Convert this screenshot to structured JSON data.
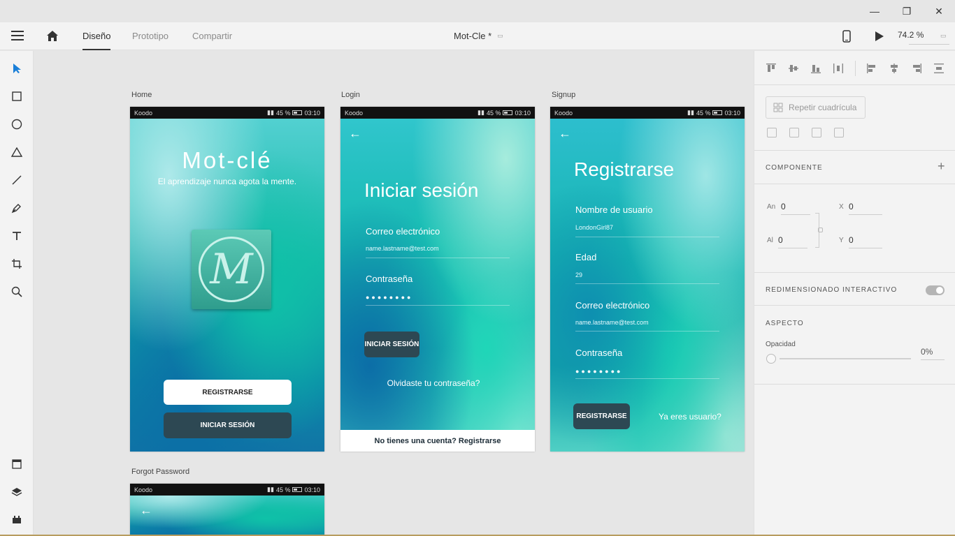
{
  "window": {
    "minimize": "—",
    "restore": "❐",
    "close": "✕"
  },
  "toolbar": {
    "tabs": [
      "Diseño",
      "Prototipo",
      "Compartir"
    ],
    "doc_title": "Mot-Cle *",
    "zoom": "74.2 %"
  },
  "canvas": {
    "artboards": {
      "home": {
        "label": "Home",
        "carrier": "Koodo",
        "battery": "45 %",
        "time": "03:10",
        "title": "Mot-clé",
        "subtitle": "El aprendizaje nunca agota la mente.",
        "logo_letter": "M",
        "register_btn": "REGISTRARSE",
        "login_btn": "INICIAR SESIÓN"
      },
      "login": {
        "label": "Login",
        "carrier": "Koodo",
        "battery": "45 %",
        "time": "03:10",
        "title": "Iniciar sesión",
        "email_label": "Correo electrónico",
        "email_value": "name.lastname@test.com",
        "password_label": "Contraseña",
        "password_dots": "●●●●●●●●",
        "login_btn": "INICIAR SESIÓN",
        "forgot": "Olvidaste tu contraseña?",
        "footer": "No tienes una cuenta? Registrarse"
      },
      "signup": {
        "label": "Signup",
        "carrier": "Koodo",
        "battery": "45 %",
        "time": "03:10",
        "title": "Registrarse",
        "username_label": "Nombre de usuario",
        "username_value": "LondonGirl87",
        "age_label": "Edad",
        "age_value": "29",
        "email_label": "Correo electrónico",
        "email_value": "name.lastname@test.com",
        "password_label": "Contraseña",
        "password_dots": "●●●●●●●●",
        "register_btn": "REGISTRARSE",
        "already": "Ya eres usuario?"
      },
      "forgot": {
        "label": "Forgot Password",
        "carrier": "Koodo",
        "battery": "45 %",
        "time": "03:10"
      }
    }
  },
  "panel": {
    "repeat_grid": "Repetir cuadrícula",
    "component_title": "COMPONENTE",
    "component_add": "+",
    "width_label": "An",
    "width_value": "0",
    "height_label": "Al",
    "height_value": "0",
    "x_label": "X",
    "x_value": "0",
    "y_label": "Y",
    "y_value": "0",
    "responsive_title": "REDIMENSIONADO INTERACTIVO",
    "aspect_title": "ASPECTO",
    "opacity_label": "Opacidad",
    "opacity_value": "0%"
  }
}
